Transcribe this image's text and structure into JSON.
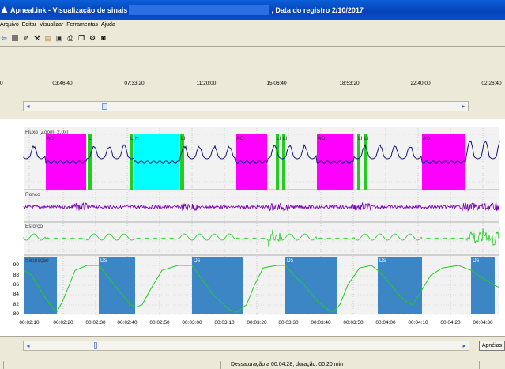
{
  "window": {
    "title_left": "Apneal.ink - Visualização de sinais",
    "title_right": ", Data do registro 2/10/2017"
  },
  "menu": [
    "Arquivo",
    "Editar",
    "Visualizar",
    "Ferramentas",
    "Ajuda"
  ],
  "toolbar_icons": [
    "back-arrow-icon",
    "stop-icon",
    "record-edit-icon",
    "tools-icon",
    "open-folder-icon",
    "save-icon",
    "print-icon",
    "copy-icon",
    "settings-icon",
    "camera-icon"
  ],
  "overview_ticks": [
    "0",
    "03:46:40",
    "07:33:20",
    "11:20:00",
    "15:06:40",
    "18:53:20",
    "22:40:00",
    "02:26:40"
  ],
  "channels": {
    "fluxo": "Fluxo (Zoom: 2.0x)",
    "ronco": "Ronco",
    "esforco": "Esforço",
    "saturacao": "Saturação"
  },
  "event_labels": {
    "ao": "AO",
    "li": "Li",
    "h": "H",
    "ds": "Ds"
  },
  "sat_axis": [
    "90",
    "88",
    "86",
    "84",
    "82",
    "80"
  ],
  "time_ticks": [
    "00:02:10",
    "00:02:20",
    "00:02:30",
    "00:02:40",
    "00:02:50",
    "00:03:00",
    "00:03:10",
    "00:03:20",
    "00:03:30",
    "00:03:40",
    "00:03:50",
    "00:04:00",
    "00:04:10",
    "00:04:20",
    "00:04:30"
  ],
  "buttons": {
    "apneias": "Apnéias"
  },
  "status": {
    "text": "Dessaturação a 00:04:28, duração: 00:20 min"
  },
  "colors": {
    "apnea": "#ff00ff",
    "hypopnea": "#00ffff",
    "limitation": "#22cc22",
    "desat": "#3d86c6",
    "flow": "#14147a",
    "snore": "#7a00b4",
    "effort": "#22cc22",
    "sat": "#22cc22"
  }
}
